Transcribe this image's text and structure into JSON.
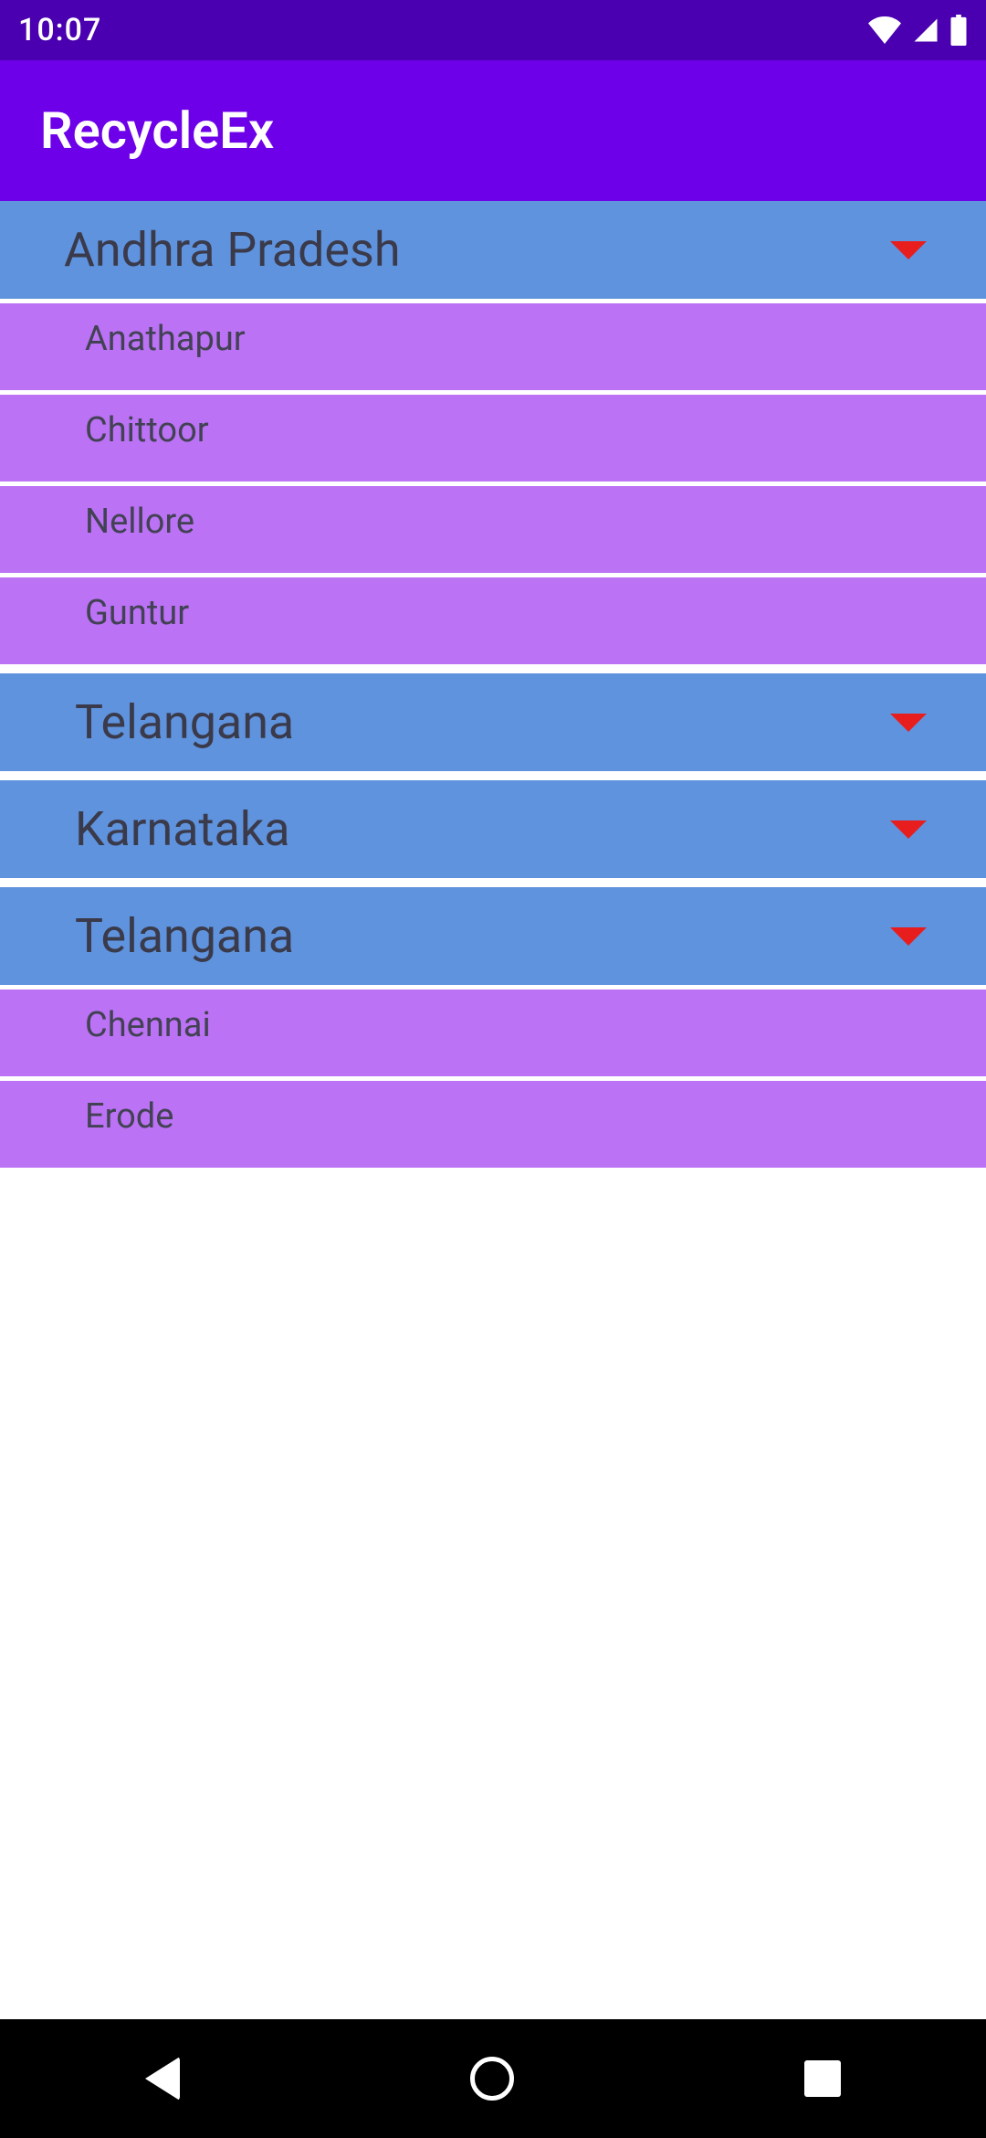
{
  "statusBar": {
    "time": "10:07"
  },
  "appBar": {
    "title": "RecycleEx"
  },
  "groups": [
    {
      "name": "Andhra Pradesh",
      "children": [
        "Anathapur",
        "Chittoor",
        "Nellore",
        "Guntur"
      ]
    },
    {
      "name": "Telangana",
      "children": []
    },
    {
      "name": "Karnataka",
      "children": []
    },
    {
      "name": "Telangana",
      "children": [
        "Chennai",
        "Erode"
      ]
    }
  ],
  "colors": {
    "statusBarBg": "#4A00B0",
    "appBarBg": "#6D00E8",
    "groupHeaderBg": "#5F93DE",
    "childItemBg": "#BB72F4",
    "dropdownIcon": "#E81E1E"
  }
}
